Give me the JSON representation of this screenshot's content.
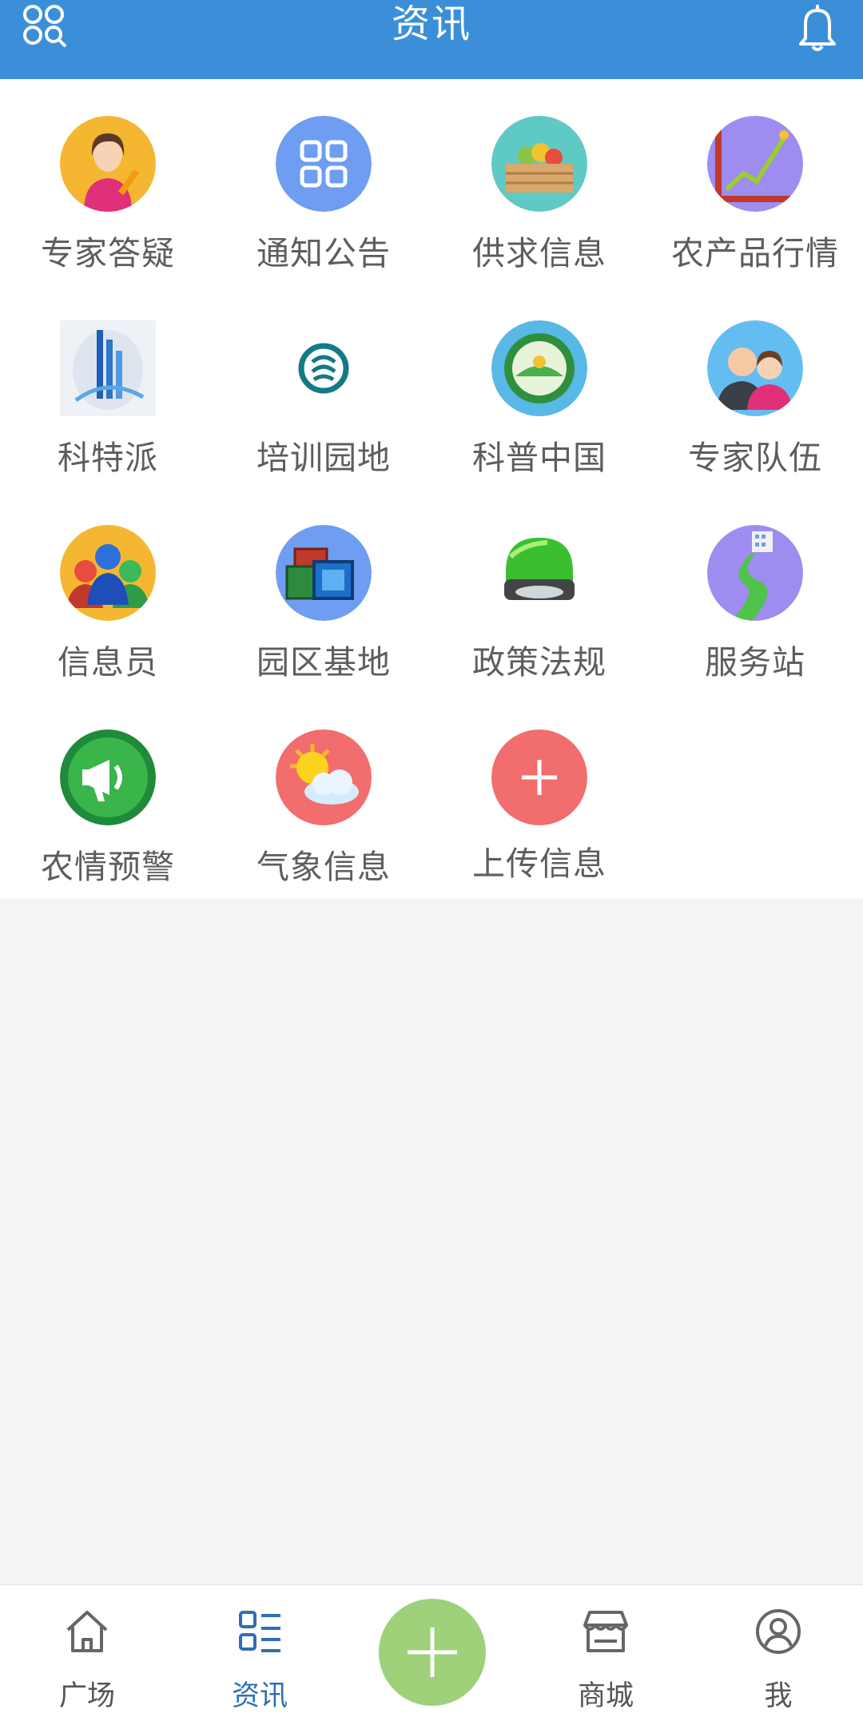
{
  "header": {
    "title": "资讯",
    "left_icon": "apps-search-icon",
    "right_icon": "bell-icon"
  },
  "grid": {
    "items": [
      {
        "label": "专家答疑",
        "icon": "expert-qa-icon"
      },
      {
        "label": "通知公告",
        "icon": "notice-grid-icon"
      },
      {
        "label": "供求信息",
        "icon": "supply-crate-icon"
      },
      {
        "label": "农产品行情",
        "icon": "market-chart-icon"
      },
      {
        "label": "科特派",
        "icon": "kete-building-icon"
      },
      {
        "label": "培训园地",
        "icon": "training-logo-icon"
      },
      {
        "label": "科普中国",
        "icon": "science-emblem-icon"
      },
      {
        "label": "专家队伍",
        "icon": "expert-team-icon"
      },
      {
        "label": "信息员",
        "icon": "informants-icon"
      },
      {
        "label": "园区基地",
        "icon": "park-base-icon"
      },
      {
        "label": "政策法规",
        "icon": "policy-disk-icon"
      },
      {
        "label": "服务站",
        "icon": "service-station-icon"
      },
      {
        "label": "农情预警",
        "icon": "alert-megaphone-icon"
      },
      {
        "label": "气象信息",
        "icon": "weather-icon"
      },
      {
        "label": "上传信息",
        "icon": "plus-icon"
      }
    ]
  },
  "nav": {
    "items": [
      {
        "label": "广场",
        "icon": "home-icon",
        "active": false
      },
      {
        "label": "资讯",
        "icon": "list-icon",
        "active": true
      },
      {
        "label": "商城",
        "icon": "store-icon",
        "active": false
      },
      {
        "label": "我",
        "icon": "user-icon",
        "active": false
      }
    ],
    "center_icon": "plus-icon"
  },
  "colors": {
    "header": "#3b8fd8",
    "active": "#2e6fb5",
    "fab": "#9fd07a",
    "upload": "#f26d6d"
  }
}
